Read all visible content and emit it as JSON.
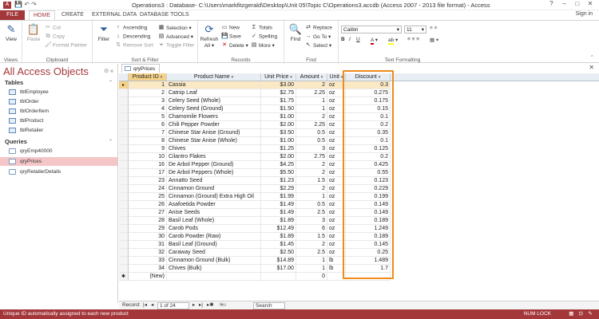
{
  "titlebar": {
    "app_icon": "A",
    "title": "Operations3 : Database- C:\\Users\\markfitzgerald\\Desktop\\Unit 05\\Topic C\\Operations3.accdb (Access 2007 - 2013 file format) - Access",
    "help": "?",
    "minimize": "–",
    "restore": "□",
    "close": "✕"
  },
  "tabs": {
    "file": "FILE",
    "home": "HOME",
    "create": "CREATE",
    "external": "EXTERNAL DATA",
    "dbtools": "DATABASE TOOLS",
    "signin": "Sign in"
  },
  "ribbon": {
    "views": {
      "view": "View",
      "label": "Views"
    },
    "clipboard": {
      "paste": "Paste",
      "cut": "Cut",
      "copy": "Copy",
      "format_painter": "Format Painter",
      "label": "Clipboard"
    },
    "sort_filter": {
      "filter": "Filter",
      "ascending": "Ascending",
      "descending": "Descending",
      "remove_sort": "Remove Sort",
      "selection": "Selection",
      "advanced": "Advanced",
      "toggle_filter": "Toggle Filter",
      "label": "Sort & Filter"
    },
    "records": {
      "refresh": "Refresh",
      "refresh_all": "All",
      "new": "New",
      "save": "Save",
      "delete": "Delete",
      "totals": "Totals",
      "spelling": "Spelling",
      "more": "More",
      "label": "Records"
    },
    "find": {
      "find": "Find",
      "replace": "Replace",
      "goto": "Go To",
      "select": "Select",
      "label": "Find"
    },
    "text_formatting": {
      "font": "Calibri",
      "size": "11",
      "label": "Text Formatting"
    }
  },
  "nav": {
    "title": "All Access Objects",
    "tables_header": "Tables",
    "tables": [
      "tblEmployee",
      "tblOrder",
      "tblOrderItem",
      "tblProduct",
      "tblRetailer"
    ],
    "queries_header": "Queries",
    "queries": [
      "qryEmp40000",
      "qryPrices",
      "qryRetailerDetails"
    ]
  },
  "doc": {
    "tab_label": "qryPrices",
    "columns": [
      "Product ID",
      "Product Name",
      "Unit Price",
      "Amount",
      "Unit",
      "Discount"
    ],
    "rows": [
      [
        "1",
        "Cassia",
        "$3.00",
        "2",
        "oz",
        "0.3"
      ],
      [
        "2",
        "Catnip Leaf",
        "$2.75",
        "2.25",
        "oz",
        "0.275"
      ],
      [
        "3",
        "Celery Seed (Whole)",
        "$1.75",
        "1",
        "oz",
        "0.175"
      ],
      [
        "4",
        "Celery Seed (Ground)",
        "$1.50",
        "1",
        "oz",
        "0.15"
      ],
      [
        "5",
        "Chamomile Flowers",
        "$1.00",
        "2",
        "oz",
        "0.1"
      ],
      [
        "6",
        "Chili Pepper Powder",
        "$2.00",
        "2.25",
        "oz",
        "0.2"
      ],
      [
        "7",
        "Chinese Star Anise (Ground)",
        "$3.50",
        "0.5",
        "oz",
        "0.35"
      ],
      [
        "8",
        "Chinese Star Anise (Whole)",
        "$1.00",
        "0.5",
        "oz",
        "0.1"
      ],
      [
        "9",
        "Chives",
        "$1.25",
        "3",
        "oz",
        "0.125"
      ],
      [
        "10",
        "Cilantro Flakes",
        "$2.00",
        "2.75",
        "oz",
        "0.2"
      ],
      [
        "16",
        "De Arbol Pepper (Ground)",
        "$4.25",
        "2",
        "oz",
        "0.425"
      ],
      [
        "17",
        "De Arbol Peppers (Whole)",
        "$5.50",
        "2",
        "oz",
        "0.55"
      ],
      [
        "23",
        "Annatto Seed",
        "$1.23",
        "1.5",
        "oz",
        "0.123"
      ],
      [
        "24",
        "Cinnamon Ground",
        "$2.29",
        "2",
        "oz",
        "0.229"
      ],
      [
        "25",
        "Cinnamon (Ground) Extra High Oil",
        "$1.99",
        "1",
        "oz",
        "0.199"
      ],
      [
        "26",
        "Asafoetida Powder",
        "$1.49",
        "0.5",
        "oz",
        "0.149"
      ],
      [
        "27",
        "Anise Seeds",
        "$1.49",
        "2.5",
        "oz",
        "0.149"
      ],
      [
        "28",
        "Basil Leaf (Whole)",
        "$1.89",
        "3",
        "oz",
        "0.189"
      ],
      [
        "29",
        "Carob Pods",
        "$12.49",
        "6",
        "oz",
        "1.249"
      ],
      [
        "30",
        "Carob Powder (Raw)",
        "$1.89",
        "1.5",
        "oz",
        "0.189"
      ],
      [
        "31",
        "Basil Leaf (Ground)",
        "$1.45",
        "2",
        "oz",
        "0.145"
      ],
      [
        "32",
        "Caraway Seed",
        "$2.50",
        "2.5",
        "oz",
        "0.25"
      ],
      [
        "33",
        "Cinnamon Ground (Bulk)",
        "$14.89",
        "1",
        "lb",
        "1.489"
      ],
      [
        "34",
        "Chives (Bulk)",
        "$17.00",
        "1",
        "lb",
        "1.7"
      ]
    ],
    "new_row": {
      "id": "(New)",
      "amount": "0",
      "marker": "✱"
    }
  },
  "recnav": {
    "label": "Record:",
    "first": "|◂",
    "prev": "◂",
    "position": "1 of 24",
    "next": "▸",
    "last": "▸|",
    "new": "▸✱",
    "filter": "No Filter",
    "search": "Search"
  },
  "status": {
    "message": "Unique ID  automatically assigned to each new product",
    "numlock": "NUM LOCK"
  },
  "colors": {
    "access_red": "#a4373a",
    "highlight_orange": "#f08c1c",
    "selected_nav": "#f5c6c8"
  }
}
